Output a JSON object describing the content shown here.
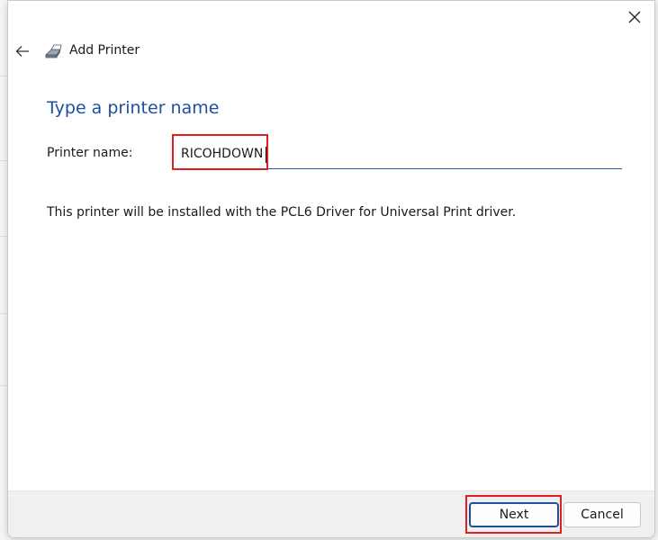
{
  "window": {
    "title": "Add Printer",
    "close_icon": "close-icon",
    "back_icon": "back-arrow-icon",
    "printer_icon": "printer-icon"
  },
  "main": {
    "heading": "Type a printer name",
    "printer_name_label": "Printer name:",
    "printer_name_value": "RICOHDOWN",
    "driver_info": "This printer will be installed with the PCL6 Driver for Universal Print driver."
  },
  "footer": {
    "next_label": "Next",
    "cancel_label": "Cancel"
  },
  "colors": {
    "heading": "#1e4fa0",
    "input_underline": "#2b5797",
    "highlight": "#e02020",
    "footer_bg": "#f0f0f0"
  }
}
